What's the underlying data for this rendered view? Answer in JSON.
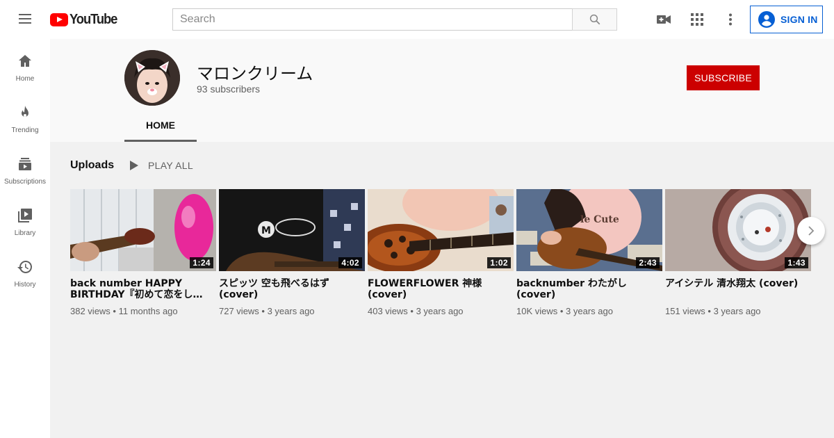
{
  "header": {
    "logo_text": "YouTube",
    "search_placeholder": "Search",
    "signin_label": "SIGN IN",
    "icons": [
      "menu-icon",
      "search-icon",
      "video-camera-icon",
      "apps-grid-icon",
      "more-vertical-icon",
      "account-circle-icon"
    ]
  },
  "sidebar": {
    "items": [
      {
        "label": "Home",
        "icon": "home-icon"
      },
      {
        "label": "Trending",
        "icon": "flame-icon"
      },
      {
        "label": "Subscriptions",
        "icon": "subscriptions-icon"
      },
      {
        "label": "Library",
        "icon": "library-icon"
      },
      {
        "label": "History",
        "icon": "history-icon"
      }
    ]
  },
  "channel": {
    "name": "マロンクリーム",
    "subscribers": "93 subscribers",
    "subscribe_label": "SUBSCRIBE",
    "tab_home": "HOME"
  },
  "uploads": {
    "title": "Uploads",
    "play_all_label": "PLAY ALL",
    "videos": [
      {
        "title": "back number HAPPY BIRTHDAY『初めて恋をし…",
        "duration": "1:24",
        "views": "382 views",
        "age": "11 months ago"
      },
      {
        "title": "スピッツ 空も飛べるはず (cover)",
        "duration": "4:02",
        "views": "727 views",
        "age": "3 years ago"
      },
      {
        "title": "FLOWERFLOWER 神様 (cover)",
        "duration": "1:02",
        "views": "403 views",
        "age": "3 years ago"
      },
      {
        "title": "backnumber わたがし (cover)",
        "duration": "2:43",
        "views": "10K views",
        "age": "3 years ago"
      },
      {
        "title": "アイシテル 清水翔太 (cover)",
        "duration": "1:43",
        "views": "151 views",
        "age": "3 years ago"
      }
    ]
  },
  "colors": {
    "brand_red": "#ff0000",
    "subscribe_red": "#cc0000",
    "link_blue": "#065fd4",
    "icon_gray": "#606060"
  }
}
